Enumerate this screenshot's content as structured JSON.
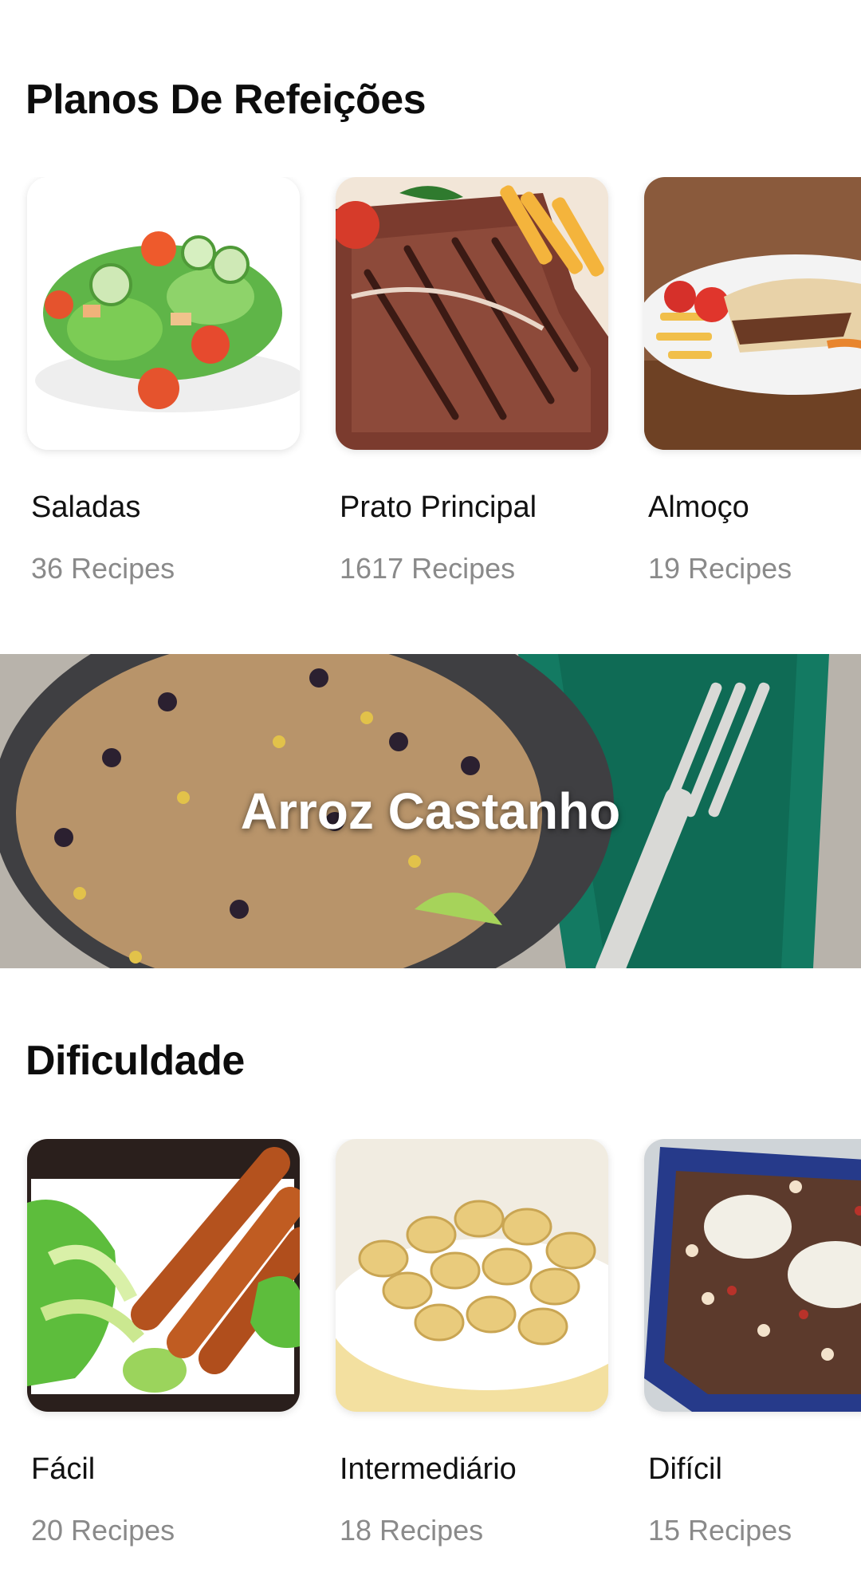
{
  "meal_plans": {
    "title": "Planos De Refeições",
    "cards": [
      {
        "name": "Saladas",
        "count": "36 Recipes"
      },
      {
        "name": "Prato Principal",
        "count": "1617 Recipes"
      },
      {
        "name": "Almoço",
        "count": "19 Recipes"
      }
    ]
  },
  "banner": {
    "title": "Arroz Castanho"
  },
  "difficulty": {
    "title": "Dificuldade",
    "cards": [
      {
        "name": "Fácil",
        "count": "20 Recipes"
      },
      {
        "name": "Intermediário",
        "count": "18 Recipes"
      },
      {
        "name": "Difícil",
        "count": "15 Recipes"
      }
    ]
  }
}
